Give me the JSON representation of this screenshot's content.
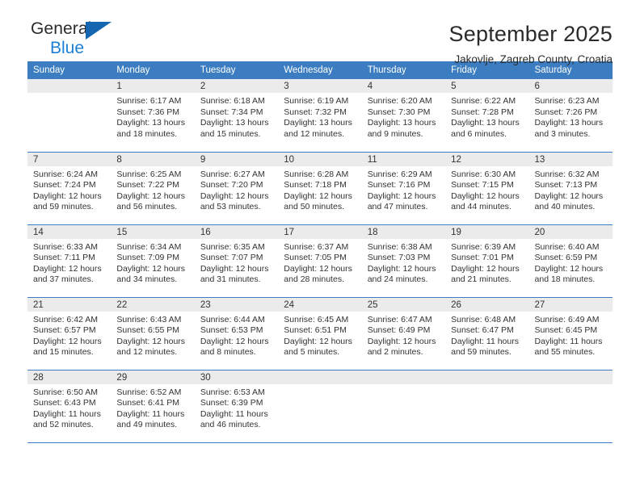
{
  "brand": {
    "name_top": "General",
    "name_bottom": "Blue",
    "accent_color": "#1c7fd4",
    "triangle_color": "#1466b0"
  },
  "header": {
    "month_title": "September 2025",
    "location": "Jakovlje, Zagreb County, Croatia"
  },
  "calendar": {
    "header_color": "#3b7dc0",
    "daynum_band_color": "#ebebeb",
    "weekday_headers": [
      "Sunday",
      "Monday",
      "Tuesday",
      "Wednesday",
      "Thursday",
      "Friday",
      "Saturday"
    ],
    "weeks": [
      [
        {
          "day": "",
          "empty": true,
          "lines": []
        },
        {
          "day": "1",
          "lines": [
            "Sunrise: 6:17 AM",
            "Sunset: 7:36 PM",
            "Daylight: 13 hours",
            "and 18 minutes."
          ]
        },
        {
          "day": "2",
          "lines": [
            "Sunrise: 6:18 AM",
            "Sunset: 7:34 PM",
            "Daylight: 13 hours",
            "and 15 minutes."
          ]
        },
        {
          "day": "3",
          "lines": [
            "Sunrise: 6:19 AM",
            "Sunset: 7:32 PM",
            "Daylight: 13 hours",
            "and 12 minutes."
          ]
        },
        {
          "day": "4",
          "lines": [
            "Sunrise: 6:20 AM",
            "Sunset: 7:30 PM",
            "Daylight: 13 hours",
            "and 9 minutes."
          ]
        },
        {
          "day": "5",
          "lines": [
            "Sunrise: 6:22 AM",
            "Sunset: 7:28 PM",
            "Daylight: 13 hours",
            "and 6 minutes."
          ]
        },
        {
          "day": "6",
          "lines": [
            "Sunrise: 6:23 AM",
            "Sunset: 7:26 PM",
            "Daylight: 13 hours",
            "and 3 minutes."
          ]
        }
      ],
      [
        {
          "day": "7",
          "lines": [
            "Sunrise: 6:24 AM",
            "Sunset: 7:24 PM",
            "Daylight: 12 hours",
            "and 59 minutes."
          ]
        },
        {
          "day": "8",
          "lines": [
            "Sunrise: 6:25 AM",
            "Sunset: 7:22 PM",
            "Daylight: 12 hours",
            "and 56 minutes."
          ]
        },
        {
          "day": "9",
          "lines": [
            "Sunrise: 6:27 AM",
            "Sunset: 7:20 PM",
            "Daylight: 12 hours",
            "and 53 minutes."
          ]
        },
        {
          "day": "10",
          "lines": [
            "Sunrise: 6:28 AM",
            "Sunset: 7:18 PM",
            "Daylight: 12 hours",
            "and 50 minutes."
          ]
        },
        {
          "day": "11",
          "lines": [
            "Sunrise: 6:29 AM",
            "Sunset: 7:16 PM",
            "Daylight: 12 hours",
            "and 47 minutes."
          ]
        },
        {
          "day": "12",
          "lines": [
            "Sunrise: 6:30 AM",
            "Sunset: 7:15 PM",
            "Daylight: 12 hours",
            "and 44 minutes."
          ]
        },
        {
          "day": "13",
          "lines": [
            "Sunrise: 6:32 AM",
            "Sunset: 7:13 PM",
            "Daylight: 12 hours",
            "and 40 minutes."
          ]
        }
      ],
      [
        {
          "day": "14",
          "lines": [
            "Sunrise: 6:33 AM",
            "Sunset: 7:11 PM",
            "Daylight: 12 hours",
            "and 37 minutes."
          ]
        },
        {
          "day": "15",
          "lines": [
            "Sunrise: 6:34 AM",
            "Sunset: 7:09 PM",
            "Daylight: 12 hours",
            "and 34 minutes."
          ]
        },
        {
          "day": "16",
          "lines": [
            "Sunrise: 6:35 AM",
            "Sunset: 7:07 PM",
            "Daylight: 12 hours",
            "and 31 minutes."
          ]
        },
        {
          "day": "17",
          "lines": [
            "Sunrise: 6:37 AM",
            "Sunset: 7:05 PM",
            "Daylight: 12 hours",
            "and 28 minutes."
          ]
        },
        {
          "day": "18",
          "lines": [
            "Sunrise: 6:38 AM",
            "Sunset: 7:03 PM",
            "Daylight: 12 hours",
            "and 24 minutes."
          ]
        },
        {
          "day": "19",
          "lines": [
            "Sunrise: 6:39 AM",
            "Sunset: 7:01 PM",
            "Daylight: 12 hours",
            "and 21 minutes."
          ]
        },
        {
          "day": "20",
          "lines": [
            "Sunrise: 6:40 AM",
            "Sunset: 6:59 PM",
            "Daylight: 12 hours",
            "and 18 minutes."
          ]
        }
      ],
      [
        {
          "day": "21",
          "lines": [
            "Sunrise: 6:42 AM",
            "Sunset: 6:57 PM",
            "Daylight: 12 hours",
            "and 15 minutes."
          ]
        },
        {
          "day": "22",
          "lines": [
            "Sunrise: 6:43 AM",
            "Sunset: 6:55 PM",
            "Daylight: 12 hours",
            "and 12 minutes."
          ]
        },
        {
          "day": "23",
          "lines": [
            "Sunrise: 6:44 AM",
            "Sunset: 6:53 PM",
            "Daylight: 12 hours",
            "and 8 minutes."
          ]
        },
        {
          "day": "24",
          "lines": [
            "Sunrise: 6:45 AM",
            "Sunset: 6:51 PM",
            "Daylight: 12 hours",
            "and 5 minutes."
          ]
        },
        {
          "day": "25",
          "lines": [
            "Sunrise: 6:47 AM",
            "Sunset: 6:49 PM",
            "Daylight: 12 hours",
            "and 2 minutes."
          ]
        },
        {
          "day": "26",
          "lines": [
            "Sunrise: 6:48 AM",
            "Sunset: 6:47 PM",
            "Daylight: 11 hours",
            "and 59 minutes."
          ]
        },
        {
          "day": "27",
          "lines": [
            "Sunrise: 6:49 AM",
            "Sunset: 6:45 PM",
            "Daylight: 11 hours",
            "and 55 minutes."
          ]
        }
      ],
      [
        {
          "day": "28",
          "lines": [
            "Sunrise: 6:50 AM",
            "Sunset: 6:43 PM",
            "Daylight: 11 hours",
            "and 52 minutes."
          ]
        },
        {
          "day": "29",
          "lines": [
            "Sunrise: 6:52 AM",
            "Sunset: 6:41 PM",
            "Daylight: 11 hours",
            "and 49 minutes."
          ]
        },
        {
          "day": "30",
          "lines": [
            "Sunrise: 6:53 AM",
            "Sunset: 6:39 PM",
            "Daylight: 11 hours",
            "and 46 minutes."
          ]
        },
        {
          "day": "",
          "empty": true,
          "lines": []
        },
        {
          "day": "",
          "empty": true,
          "lines": []
        },
        {
          "day": "",
          "empty": true,
          "lines": []
        },
        {
          "day": "",
          "empty": true,
          "lines": []
        }
      ]
    ]
  }
}
